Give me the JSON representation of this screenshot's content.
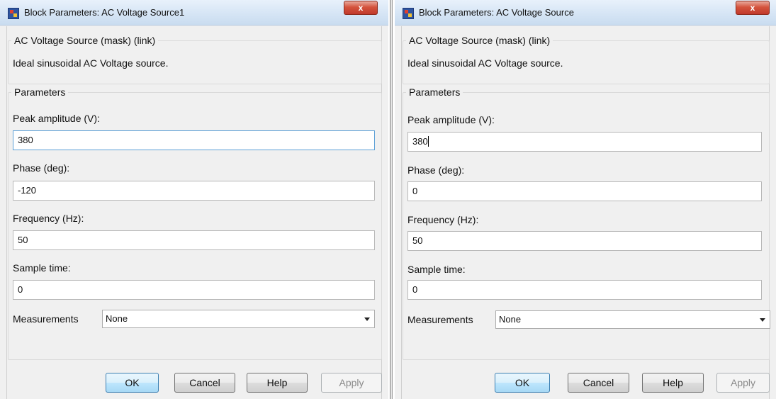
{
  "dialogs": [
    {
      "title": "Block Parameters: AC Voltage Source1",
      "close_label": "x",
      "block_group": "AC Voltage Source (mask) (link)",
      "description": "Ideal sinusoidal AC Voltage source.",
      "params_group": "Parameters",
      "fields": [
        {
          "label": "Peak amplitude (V):",
          "value": "380"
        },
        {
          "label": "Phase (deg):",
          "value": "-120"
        },
        {
          "label": "Frequency (Hz):",
          "value": "50"
        },
        {
          "label": "Sample time:",
          "value": "0"
        }
      ],
      "measurements": {
        "label": "Measurements",
        "value": "None"
      },
      "buttons": {
        "ok": "OK",
        "cancel": "Cancel",
        "help": "Help",
        "apply": "Apply"
      }
    },
    {
      "title": "Block Parameters: AC Voltage Source",
      "close_label": "x",
      "block_group": "AC Voltage Source (mask) (link)",
      "description": "Ideal sinusoidal AC Voltage source.",
      "params_group": "Parameters",
      "fields": [
        {
          "label": "Peak amplitude (V):",
          "value": "380"
        },
        {
          "label": "Phase (deg):",
          "value": "0"
        },
        {
          "label": "Frequency (Hz):",
          "value": "50"
        },
        {
          "label": "Sample time:",
          "value": "0"
        }
      ],
      "measurements": {
        "label": "Measurements",
        "value": "None"
      },
      "buttons": {
        "ok": "OK",
        "cancel": "Cancel",
        "help": "Help",
        "apply": "Apply"
      }
    }
  ]
}
